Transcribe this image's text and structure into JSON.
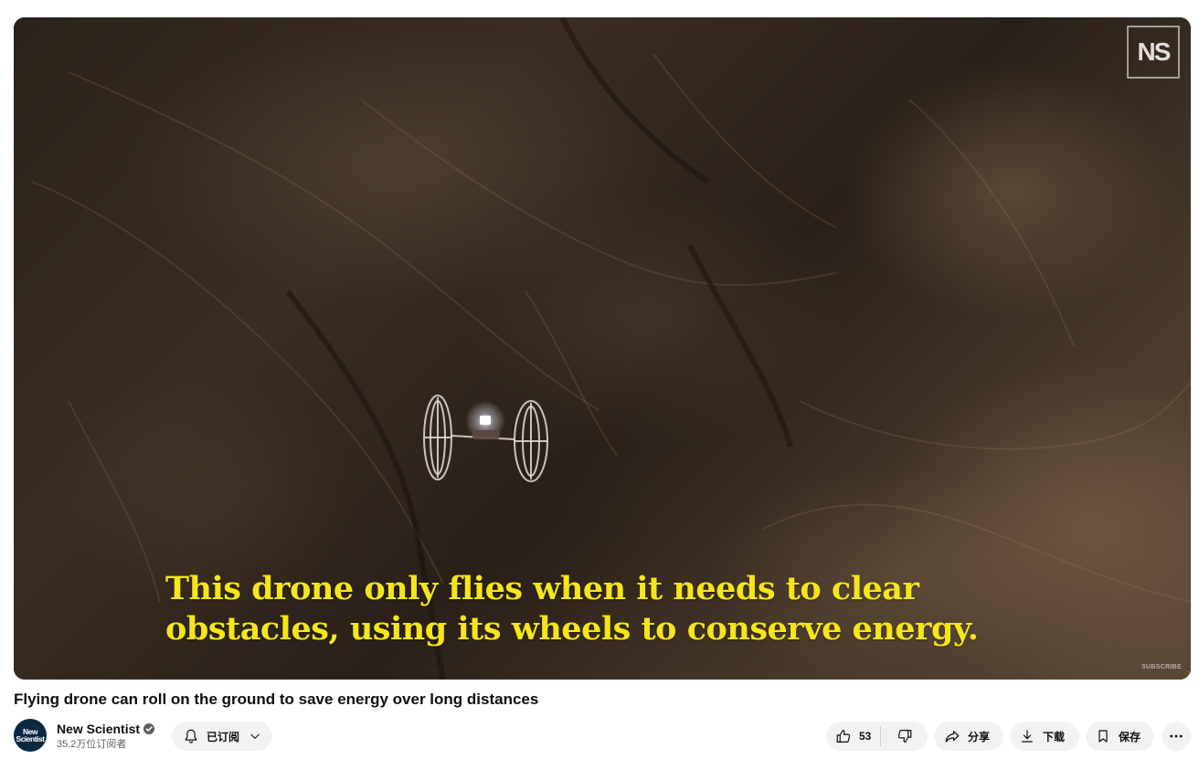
{
  "player": {
    "caption_line1": "This drone only flies when it needs to clear",
    "caption_line2": "obstacles, using its wheels to conserve energy.",
    "logo_text": "NS",
    "watermark": "SUBSCRIBE"
  },
  "video": {
    "title": "Flying drone can roll on the ground to save energy over long distances"
  },
  "channel": {
    "avatar_line1": "New",
    "avatar_line2": "Scientist",
    "name": "New Scientist",
    "verified_icon": "verified-check-icon",
    "subscribers": "35.2万位订阅者"
  },
  "actions": {
    "subscribed_label": "已订阅",
    "like_count": "53",
    "share_label": "分享",
    "download_label": "下载",
    "save_label": "保存"
  },
  "colors": {
    "caption": "#f5e51b",
    "pill_bg": "#f2f2f2",
    "avatar_bg": "#0a2840"
  }
}
